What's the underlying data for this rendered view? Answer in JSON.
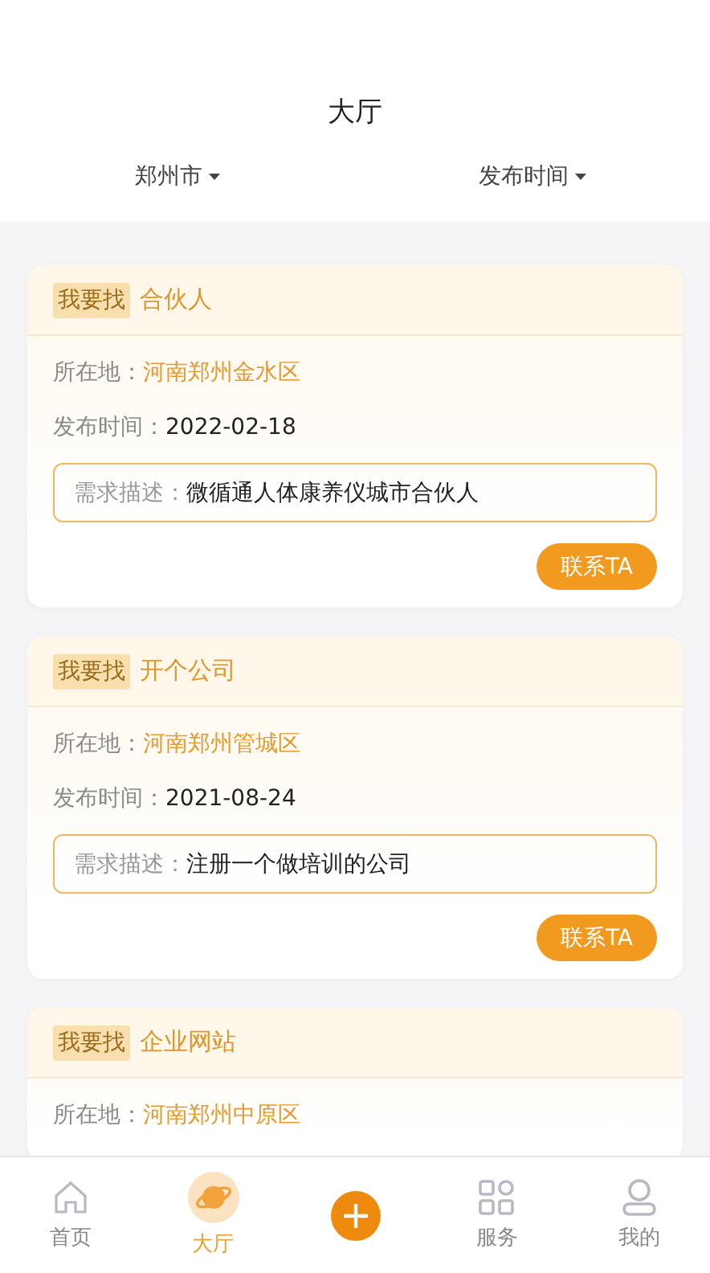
{
  "header": {
    "title": "大厅"
  },
  "filters": [
    {
      "label": "郑州市"
    },
    {
      "label": "发布时间"
    }
  ],
  "posts": [
    {
      "tag": "我要找",
      "title": "合伙人",
      "location_label": "所在地：",
      "location": "河南郑州金水区",
      "date_label": "发布时间：",
      "date": "2022-02-18",
      "desc_label": "需求描述：",
      "desc": "微循通人体康养仪城市合伙人",
      "action": "联系TA"
    },
    {
      "tag": "我要找",
      "title": "开个公司",
      "location_label": "所在地：",
      "location": "河南郑州管城区",
      "date_label": "发布时间：",
      "date": "2021-08-24",
      "desc_label": "需求描述：",
      "desc": "注册一个做培训的公司",
      "action": "联系TA"
    },
    {
      "tag": "我要找",
      "title": "企业网站",
      "location_label": "所在地：",
      "location": "河南郑州中原区"
    }
  ],
  "tabbar": [
    {
      "kind": "home",
      "label": "首页",
      "selected": false
    },
    {
      "kind": "planet",
      "label": "大厅",
      "selected": true
    },
    {
      "kind": "add",
      "selected": false
    },
    {
      "kind": "grid",
      "label": "服务",
      "selected": false
    },
    {
      "kind": "user",
      "label": "我的",
      "selected": false
    }
  ]
}
